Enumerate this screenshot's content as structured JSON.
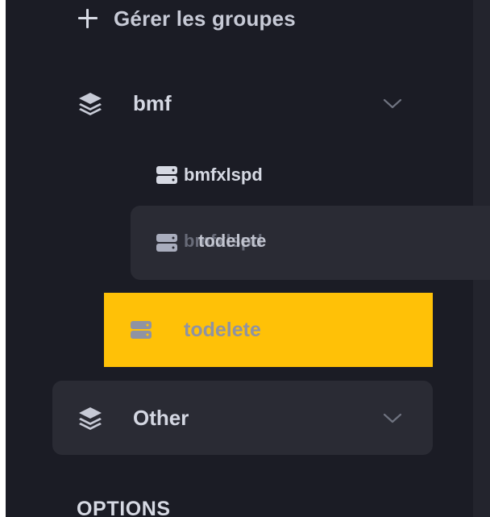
{
  "navigation": {
    "manage_groups_label": "Gérer les groupes",
    "manage_groups_icon": "plus-icon",
    "groups": [
      {
        "label": "bmf",
        "icon": "layers-icon",
        "expanded": true,
        "items": [
          {
            "label": "bmfxlspd",
            "icon": "server-icon"
          }
        ]
      },
      {
        "label": "Other",
        "icon": "layers-icon",
        "expanded": false
      }
    ],
    "drag_preview": {
      "underlying_label": "bmfxlspd",
      "dragging_label": "todelete",
      "icon": "server-icon"
    },
    "drop_target": {
      "label": "todelete",
      "icon": "server-icon"
    },
    "options_heading": "OPTIONS"
  },
  "colors": {
    "sidebar_background": "#1b1c25",
    "hover_card": "#2a2b34",
    "drop_highlight": "#ffc107",
    "text": "#d4d7e2",
    "muted_icon": "#8f93a3"
  }
}
